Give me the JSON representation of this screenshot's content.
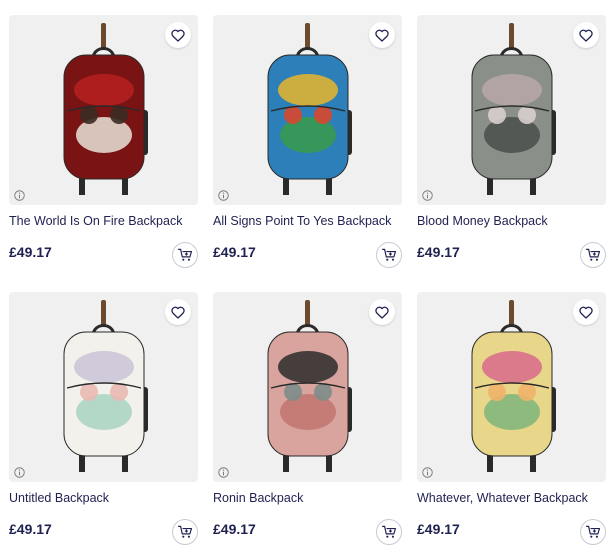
{
  "products": [
    {
      "title": "The World Is On Fire Backpack",
      "price": "£49.17",
      "colors": [
        "#7a1414",
        "#b82020",
        "#e9e3d8",
        "#3a2b22"
      ]
    },
    {
      "title": "All Signs Point To Yes Backpack",
      "price": "£49.17",
      "colors": [
        "#2c7fb8",
        "#e9b52a",
        "#3a9b4a",
        "#d8482c"
      ]
    },
    {
      "title": "Blood Money Backpack",
      "price": "£49.17",
      "colors": [
        "#8a8f8a",
        "#b8a7a9",
        "#4a4f4a",
        "#d8cfcb"
      ]
    },
    {
      "title": "Untitled Backpack",
      "price": "£49.17",
      "colors": [
        "#f3f1ec",
        "#c9c3d8",
        "#a7d3c2",
        "#e8b9b2"
      ]
    },
    {
      "title": "Ronin Backpack",
      "price": "£49.17",
      "colors": [
        "#d9a49e",
        "#2b2b2b",
        "#c2766e",
        "#7d8d8a"
      ]
    },
    {
      "title": "Whatever, Whatever Backpack",
      "price": "£49.17",
      "colors": [
        "#e8d68a",
        "#d86a8a",
        "#7fb57a",
        "#f0b46a"
      ]
    }
  ],
  "icons": {
    "favorite": "heart-icon",
    "cart": "add-to-cart-icon",
    "info": "info-icon"
  }
}
